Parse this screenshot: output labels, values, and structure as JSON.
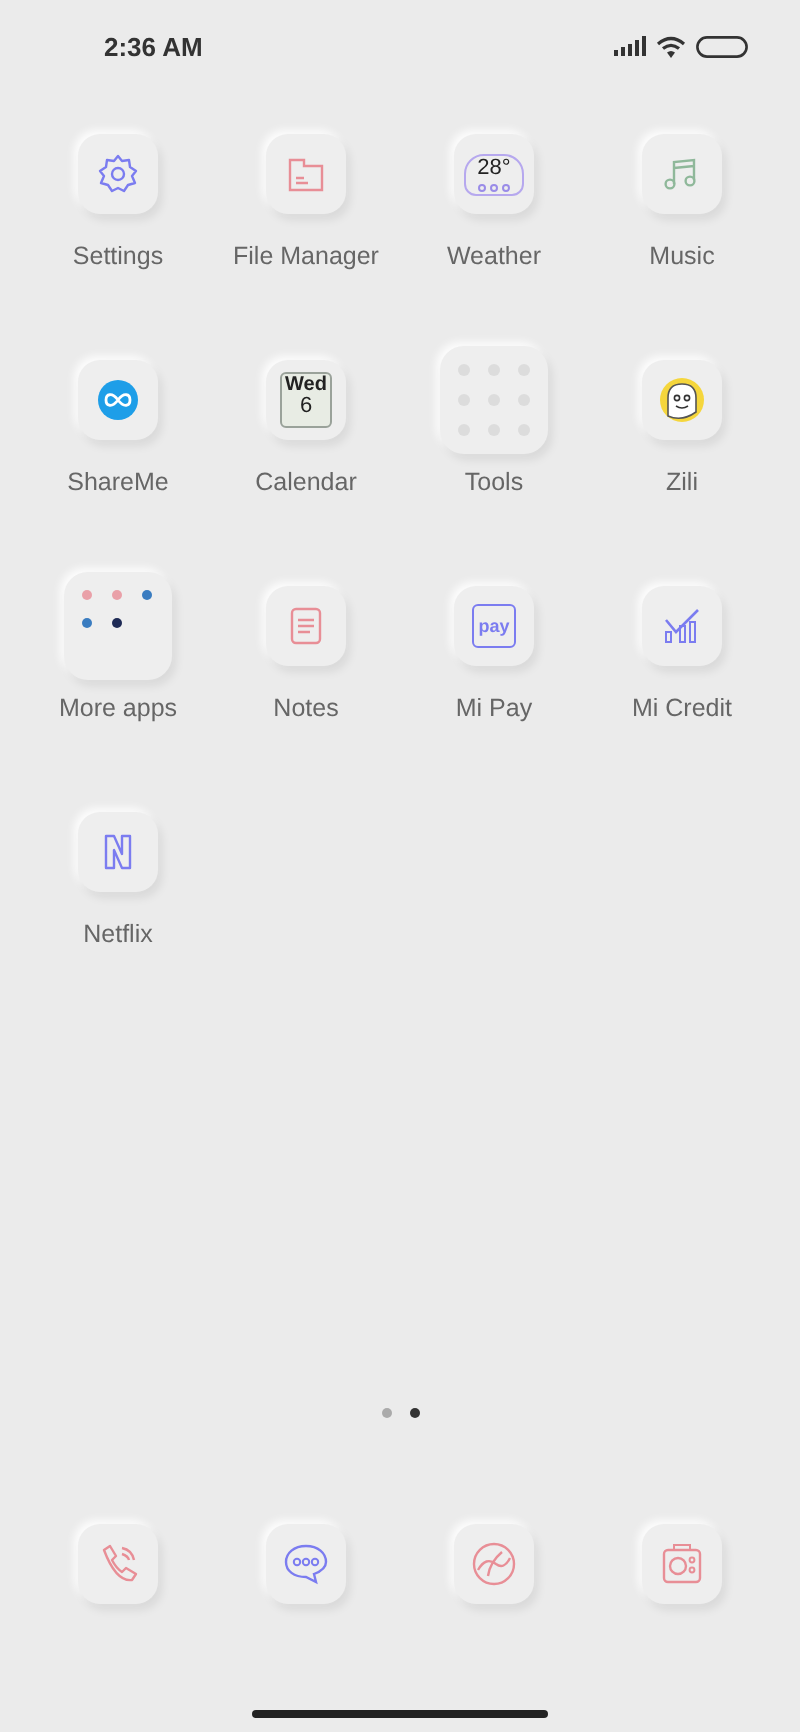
{
  "status_bar": {
    "time": "2:36 AM"
  },
  "apps": [
    {
      "label": "Settings",
      "kind": "gear"
    },
    {
      "label": "File Manager",
      "kind": "file"
    },
    {
      "label": "Weather",
      "kind": "weather",
      "temperature": "28°"
    },
    {
      "label": "Music",
      "kind": "music"
    },
    {
      "label": "ShareMe",
      "kind": "share"
    },
    {
      "label": "Calendar",
      "kind": "calendar",
      "weekday": "Wed",
      "day": "6"
    },
    {
      "label": "Tools",
      "kind": "folder9"
    },
    {
      "label": "Zili",
      "kind": "zili"
    },
    {
      "label": "More apps",
      "kind": "folder5"
    },
    {
      "label": "Notes",
      "kind": "notes"
    },
    {
      "label": "Mi Pay",
      "kind": "pay",
      "badge": "pay"
    },
    {
      "label": "Mi Credit",
      "kind": "credit"
    },
    {
      "label": "Netflix",
      "kind": "netflix"
    }
  ],
  "page_dots": [
    {
      "selected": false
    },
    {
      "selected": true
    }
  ],
  "dock": [
    {
      "kind": "phone"
    },
    {
      "kind": "chat"
    },
    {
      "kind": "browser"
    },
    {
      "kind": "camera"
    }
  ]
}
